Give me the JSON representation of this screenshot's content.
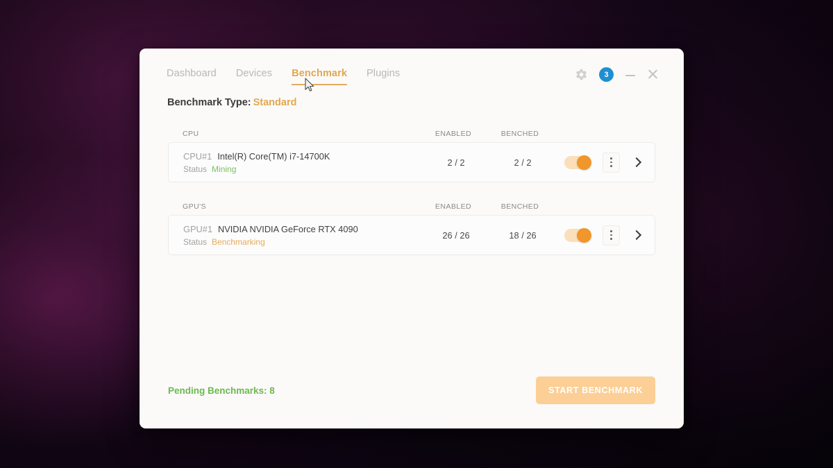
{
  "window": {
    "tabs": [
      {
        "label": "Dashboard",
        "active": false
      },
      {
        "label": "Devices",
        "active": false
      },
      {
        "label": "Benchmark",
        "active": true
      },
      {
        "label": "Plugins",
        "active": false
      }
    ],
    "controls": {
      "gear_icon": "gear-icon",
      "notification_count": "3",
      "minimize_icon": "minimize-icon",
      "close_icon": "close-icon"
    }
  },
  "benchmark_type": {
    "label": "Benchmark Type:",
    "value": "Standard"
  },
  "sections": [
    {
      "title": "CPU",
      "col_enabled": "ENABLED",
      "col_benched": "BENCHED",
      "rows": [
        {
          "id": "CPU#1",
          "name": "Intel(R) Core(TM) i7-14700K",
          "status_label": "Status",
          "status_value": "Mining",
          "status_kind": "mining",
          "enabled": "2 / 2",
          "benched": "2 / 2",
          "toggle_on": true,
          "menu_icon": "vertical-dots-icon",
          "expand_icon": "chevron-right-icon"
        }
      ]
    },
    {
      "title": "GPU'S",
      "col_enabled": "ENABLED",
      "col_benched": "BENCHED",
      "rows": [
        {
          "id": "GPU#1",
          "name": "NVIDIA NVIDIA GeForce RTX 4090",
          "status_label": "Status",
          "status_value": "Benchmarking",
          "status_kind": "benchmarking",
          "enabled": "26 / 26",
          "benched": "18 / 26",
          "toggle_on": true,
          "menu_icon": "vertical-dots-icon",
          "expand_icon": "chevron-right-icon"
        }
      ]
    }
  ],
  "footer": {
    "pending_benchmarks": "Pending Benchmarks: 8",
    "start_button": "START BENCHMARK"
  },
  "colors": {
    "accent_orange": "#e3ab5b",
    "toggle_knob": "#f0962a",
    "toggle_track": "#fadfba",
    "status_mining_green": "#79bf63",
    "status_benchmarking_orange": "#e3ab5b",
    "pending_green": "#6cb94f",
    "badge_blue": "#1f8fd2",
    "button_peach": "#fbcf96",
    "window_bg": "#fbfaf9"
  }
}
